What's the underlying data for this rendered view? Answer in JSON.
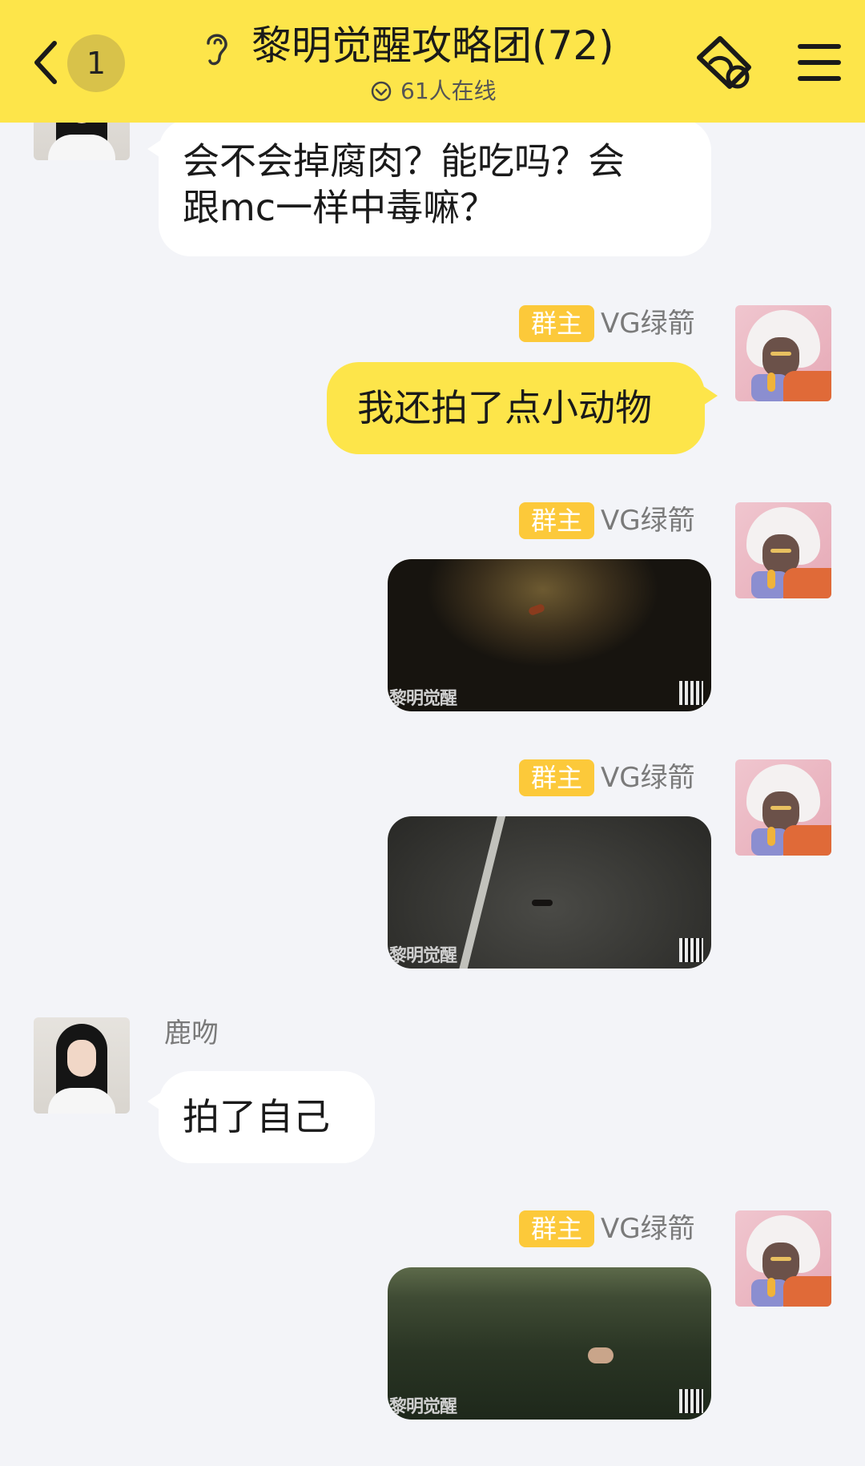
{
  "header": {
    "unread_count": "1",
    "title": "黎明觉醒攻略团(72)",
    "online_status": "61人在线"
  },
  "messages": [
    {
      "type": "text",
      "side": "left",
      "avatar": "avatar-girl",
      "text_line1": "会不会掉腐肉？能吃吗？会",
      "text_line2": "跟mc一样中毒嘛？"
    },
    {
      "type": "text",
      "side": "right",
      "role": "群主",
      "sender": "VG绿箭",
      "avatar": "avatar-boy",
      "text": "我还拍了点小动物"
    },
    {
      "type": "image",
      "side": "right",
      "role": "群主",
      "sender": "VG绿箭",
      "avatar": "avatar-boy",
      "watermark": "黎明觉醒"
    },
    {
      "type": "image",
      "side": "right",
      "role": "群主",
      "sender": "VG绿箭",
      "avatar": "avatar-boy",
      "watermark": "黎明觉醒"
    },
    {
      "type": "text",
      "side": "left",
      "sender": "鹿吻",
      "avatar": "avatar-girl",
      "text": "拍了自己"
    },
    {
      "type": "image",
      "side": "right",
      "role": "群主",
      "sender": "VG绿箭",
      "avatar": "avatar-boy",
      "watermark": "黎明觉醒"
    }
  ],
  "colors": {
    "header_bg": "#fde54a",
    "page_bg": "#f3f4f8",
    "my_bubble": "#fde54a",
    "other_bubble": "#ffffff",
    "role_badge": "#fcc93a"
  }
}
